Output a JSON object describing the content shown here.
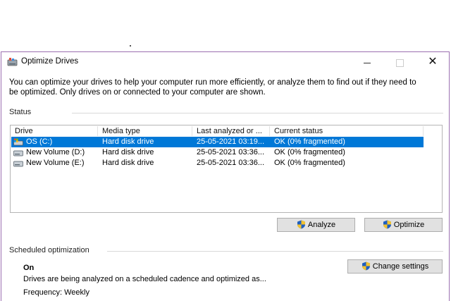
{
  "window": {
    "title": "Optimize Drives",
    "description": "You can optimize your drives to help your computer run more efficiently, or analyze them to find out if they need to be optimized. Only drives on or connected to your computer are shown."
  },
  "status": {
    "label": "Status",
    "columns": [
      "Drive",
      "Media type",
      "Last analyzed or ...",
      "Current status"
    ],
    "rows": [
      {
        "drive": "OS (C:)",
        "media": "Hard disk drive",
        "last": "25-05-2021 03:19...",
        "status": "OK (0% fragmented)",
        "selected": true,
        "icon": "windows-drive-icon"
      },
      {
        "drive": "New Volume (D:)",
        "media": "Hard disk drive",
        "last": "25-05-2021 03:36...",
        "status": "OK (0% fragmented)",
        "selected": false,
        "icon": "hard-drive-icon"
      },
      {
        "drive": "New Volume (E:)",
        "media": "Hard disk drive",
        "last": "25-05-2021 03:36...",
        "status": "OK (0% fragmented)",
        "selected": false,
        "icon": "hard-drive-icon"
      }
    ]
  },
  "buttons": {
    "analyze": "Analyze",
    "optimize": "Optimize",
    "change_settings": "Change settings"
  },
  "scheduled": {
    "label": "Scheduled optimization",
    "state": "On",
    "description": "Drives are being analyzed on a scheduled cadence and optimized as...",
    "frequency": "Frequency: Weekly"
  },
  "colors": {
    "selection": "#0078d7",
    "window_border": "#9b6fb0"
  }
}
